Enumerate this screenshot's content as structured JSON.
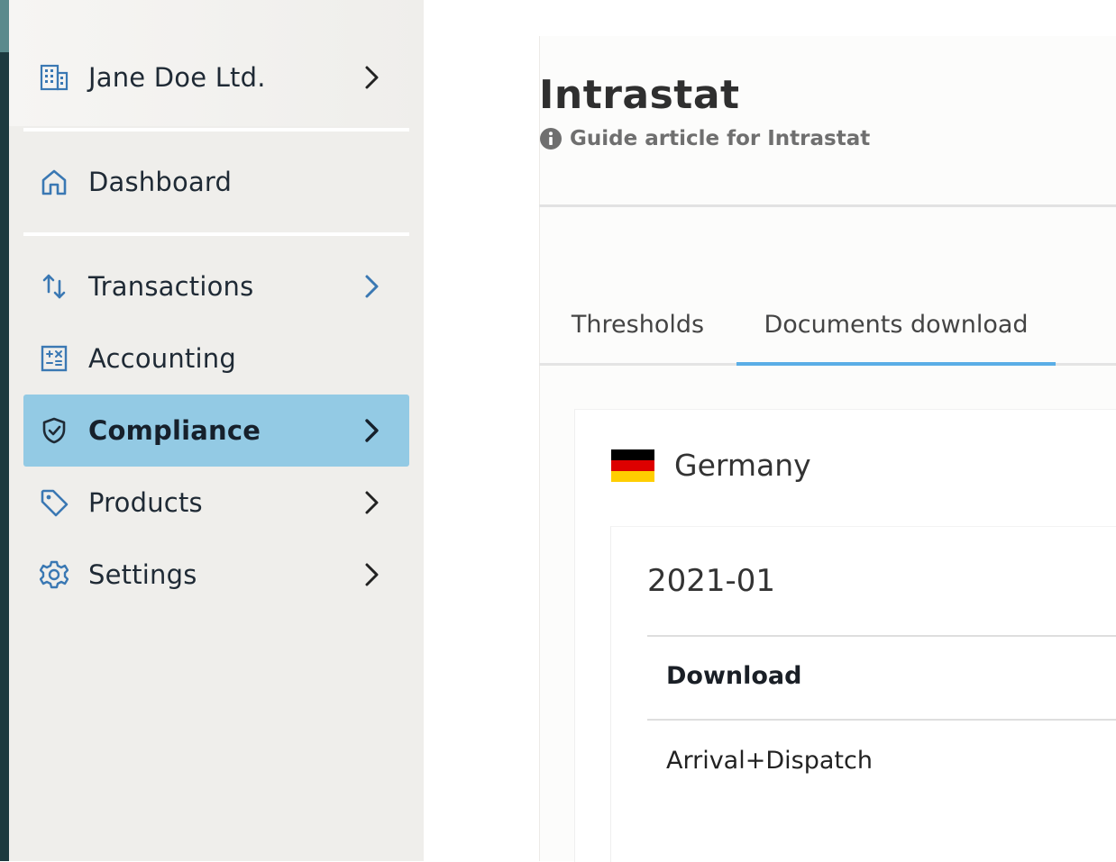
{
  "sidebar": {
    "company": "Jane Doe Ltd.",
    "items": [
      {
        "label": "Dashboard"
      },
      {
        "label": "Transactions"
      },
      {
        "label": "Accounting"
      },
      {
        "label": "Compliance"
      },
      {
        "label": "Products"
      },
      {
        "label": "Settings"
      }
    ],
    "active_index": 3
  },
  "header": {
    "title": "Intrastat",
    "guide_link": "Guide article for Intrastat"
  },
  "tabs": [
    {
      "label": "Thresholds"
    },
    {
      "label": "Documents download"
    }
  ],
  "active_tab": 1,
  "country": {
    "name": "Germany",
    "flag_colors": [
      "#000000",
      "#dd0000",
      "#ffce00"
    ]
  },
  "documents": {
    "period": "2021-01",
    "column_header": "Download",
    "rows": [
      {
        "label": "Arrival+Dispatch"
      }
    ]
  },
  "colors": {
    "accent": "#5aaee6",
    "active_nav": "#93cae4",
    "icon_blue": "#3a78b3"
  }
}
